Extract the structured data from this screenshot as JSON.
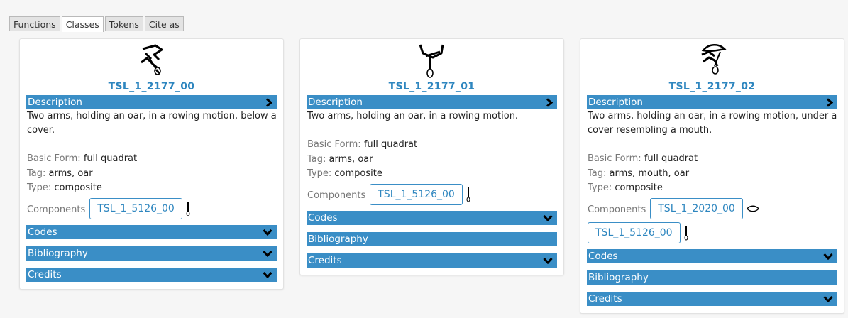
{
  "tabs": [
    {
      "label": "Functions",
      "active": false
    },
    {
      "label": "Classes",
      "active": true
    },
    {
      "label": "Tokens",
      "active": false
    },
    {
      "label": "Cite as",
      "active": false
    }
  ],
  "cards": [
    {
      "id": "TSL_1_2177_00",
      "description_label": "Description",
      "description": "Two arms, holding an oar, in a rowing motion, below a cover.",
      "basic_form_label": "Basic Form:",
      "basic_form": "full quadrat",
      "tag_label": "Tag:",
      "tag": "arms, oar",
      "type_label": "Type:",
      "type": "composite",
      "components_label": "Components",
      "components": [
        "TSL_1_5126_00"
      ],
      "codes_label": "Codes",
      "bibliography_label": "Bibliography",
      "credits_label": "Credits"
    },
    {
      "id": "TSL_1_2177_01",
      "description_label": "Description",
      "description": "Two arms, holding an oar, in a rowing motion.",
      "basic_form_label": "Basic Form:",
      "basic_form": "full quadrat",
      "tag_label": "Tag:",
      "tag": "arms, oar",
      "type_label": "Type:",
      "type": "composite",
      "components_label": "Components",
      "components": [
        "TSL_1_5126_00"
      ],
      "codes_label": "Codes",
      "bibliography_label": "Bibliography",
      "credits_label": "Credits"
    },
    {
      "id": "TSL_1_2177_02",
      "description_label": "Description",
      "description": "Two arms, holding an oar, in a rowing motion, under a cover resembling a mouth.",
      "basic_form_label": "Basic Form:",
      "basic_form": "full quadrat",
      "tag_label": "Tag:",
      "tag": "arms, mouth, oar",
      "type_label": "Type:",
      "type": "composite",
      "components_label": "Components",
      "components": [
        "TSL_1_2020_00",
        "TSL_1_5126_00"
      ],
      "codes_label": "Codes",
      "bibliography_label": "Bibliography",
      "credits_label": "Credits"
    }
  ],
  "colors": {
    "accent": "#3a8ec6",
    "link": "#2e86bf",
    "muted_label": "#777777"
  }
}
